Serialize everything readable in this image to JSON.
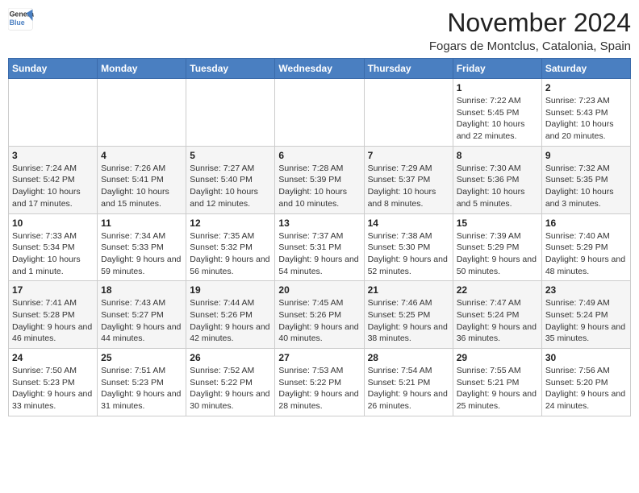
{
  "header": {
    "logo_line1": "General",
    "logo_line2": "Blue",
    "month": "November 2024",
    "location": "Fogars de Montclus, Catalonia, Spain"
  },
  "days_of_week": [
    "Sunday",
    "Monday",
    "Tuesday",
    "Wednesday",
    "Thursday",
    "Friday",
    "Saturday"
  ],
  "weeks": [
    [
      {
        "day": "",
        "info": ""
      },
      {
        "day": "",
        "info": ""
      },
      {
        "day": "",
        "info": ""
      },
      {
        "day": "",
        "info": ""
      },
      {
        "day": "",
        "info": ""
      },
      {
        "day": "1",
        "info": "Sunrise: 7:22 AM\nSunset: 5:45 PM\nDaylight: 10 hours and 22 minutes."
      },
      {
        "day": "2",
        "info": "Sunrise: 7:23 AM\nSunset: 5:43 PM\nDaylight: 10 hours and 20 minutes."
      }
    ],
    [
      {
        "day": "3",
        "info": "Sunrise: 7:24 AM\nSunset: 5:42 PM\nDaylight: 10 hours and 17 minutes."
      },
      {
        "day": "4",
        "info": "Sunrise: 7:26 AM\nSunset: 5:41 PM\nDaylight: 10 hours and 15 minutes."
      },
      {
        "day": "5",
        "info": "Sunrise: 7:27 AM\nSunset: 5:40 PM\nDaylight: 10 hours and 12 minutes."
      },
      {
        "day": "6",
        "info": "Sunrise: 7:28 AM\nSunset: 5:39 PM\nDaylight: 10 hours and 10 minutes."
      },
      {
        "day": "7",
        "info": "Sunrise: 7:29 AM\nSunset: 5:37 PM\nDaylight: 10 hours and 8 minutes."
      },
      {
        "day": "8",
        "info": "Sunrise: 7:30 AM\nSunset: 5:36 PM\nDaylight: 10 hours and 5 minutes."
      },
      {
        "day": "9",
        "info": "Sunrise: 7:32 AM\nSunset: 5:35 PM\nDaylight: 10 hours and 3 minutes."
      }
    ],
    [
      {
        "day": "10",
        "info": "Sunrise: 7:33 AM\nSunset: 5:34 PM\nDaylight: 10 hours and 1 minute."
      },
      {
        "day": "11",
        "info": "Sunrise: 7:34 AM\nSunset: 5:33 PM\nDaylight: 9 hours and 59 minutes."
      },
      {
        "day": "12",
        "info": "Sunrise: 7:35 AM\nSunset: 5:32 PM\nDaylight: 9 hours and 56 minutes."
      },
      {
        "day": "13",
        "info": "Sunrise: 7:37 AM\nSunset: 5:31 PM\nDaylight: 9 hours and 54 minutes."
      },
      {
        "day": "14",
        "info": "Sunrise: 7:38 AM\nSunset: 5:30 PM\nDaylight: 9 hours and 52 minutes."
      },
      {
        "day": "15",
        "info": "Sunrise: 7:39 AM\nSunset: 5:29 PM\nDaylight: 9 hours and 50 minutes."
      },
      {
        "day": "16",
        "info": "Sunrise: 7:40 AM\nSunset: 5:29 PM\nDaylight: 9 hours and 48 minutes."
      }
    ],
    [
      {
        "day": "17",
        "info": "Sunrise: 7:41 AM\nSunset: 5:28 PM\nDaylight: 9 hours and 46 minutes."
      },
      {
        "day": "18",
        "info": "Sunrise: 7:43 AM\nSunset: 5:27 PM\nDaylight: 9 hours and 44 minutes."
      },
      {
        "day": "19",
        "info": "Sunrise: 7:44 AM\nSunset: 5:26 PM\nDaylight: 9 hours and 42 minutes."
      },
      {
        "day": "20",
        "info": "Sunrise: 7:45 AM\nSunset: 5:26 PM\nDaylight: 9 hours and 40 minutes."
      },
      {
        "day": "21",
        "info": "Sunrise: 7:46 AM\nSunset: 5:25 PM\nDaylight: 9 hours and 38 minutes."
      },
      {
        "day": "22",
        "info": "Sunrise: 7:47 AM\nSunset: 5:24 PM\nDaylight: 9 hours and 36 minutes."
      },
      {
        "day": "23",
        "info": "Sunrise: 7:49 AM\nSunset: 5:24 PM\nDaylight: 9 hours and 35 minutes."
      }
    ],
    [
      {
        "day": "24",
        "info": "Sunrise: 7:50 AM\nSunset: 5:23 PM\nDaylight: 9 hours and 33 minutes."
      },
      {
        "day": "25",
        "info": "Sunrise: 7:51 AM\nSunset: 5:23 PM\nDaylight: 9 hours and 31 minutes."
      },
      {
        "day": "26",
        "info": "Sunrise: 7:52 AM\nSunset: 5:22 PM\nDaylight: 9 hours and 30 minutes."
      },
      {
        "day": "27",
        "info": "Sunrise: 7:53 AM\nSunset: 5:22 PM\nDaylight: 9 hours and 28 minutes."
      },
      {
        "day": "28",
        "info": "Sunrise: 7:54 AM\nSunset: 5:21 PM\nDaylight: 9 hours and 26 minutes."
      },
      {
        "day": "29",
        "info": "Sunrise: 7:55 AM\nSunset: 5:21 PM\nDaylight: 9 hours and 25 minutes."
      },
      {
        "day": "30",
        "info": "Sunrise: 7:56 AM\nSunset: 5:20 PM\nDaylight: 9 hours and 24 minutes."
      }
    ]
  ]
}
